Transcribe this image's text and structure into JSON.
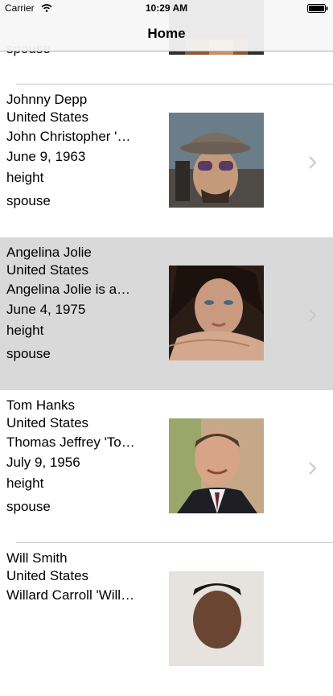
{
  "status_bar": {
    "carrier": "Carrier",
    "time": "10:29 AM",
    "wifi_icon": "wifi-icon",
    "battery_icon": "battery-full-icon"
  },
  "nav": {
    "title": "Home"
  },
  "partial_top_row": {
    "spouse": "spouse"
  },
  "people": [
    {
      "name": "Johnny Depp",
      "country": "United States",
      "description": "John Christopher 'Johnny' Depp II",
      "birthdate": "June 9, 1963",
      "height": "height",
      "spouse": "spouse",
      "photo_icon": "person-photo",
      "chevron_icon": "chevron-right-icon"
    },
    {
      "name": "Angelina Jolie",
      "country": "United States",
      "description": "Angelina Jolie is an American actress",
      "birthdate": "June 4, 1975",
      "height": "height",
      "spouse": "spouse",
      "selected": true,
      "photo_icon": "person-photo",
      "chevron_icon": "chevron-right-icon"
    },
    {
      "name": "Tom Hanks",
      "country": "United States",
      "description": "Thomas Jeffrey 'Tom' Hanks",
      "birthdate": "July 9, 1956",
      "height": "height",
      "spouse": "spouse",
      "photo_icon": "person-photo",
      "chevron_icon": "chevron-right-icon"
    },
    {
      "name": "Will Smith",
      "country": "United States",
      "description": "Willard Carroll 'Will' Smith Jr.",
      "photo_icon": "person-photo"
    }
  ],
  "colors": {
    "selected_row": "#d9d9d9",
    "separator": "#c8c7cc",
    "chevron": "#c7c7cc"
  }
}
